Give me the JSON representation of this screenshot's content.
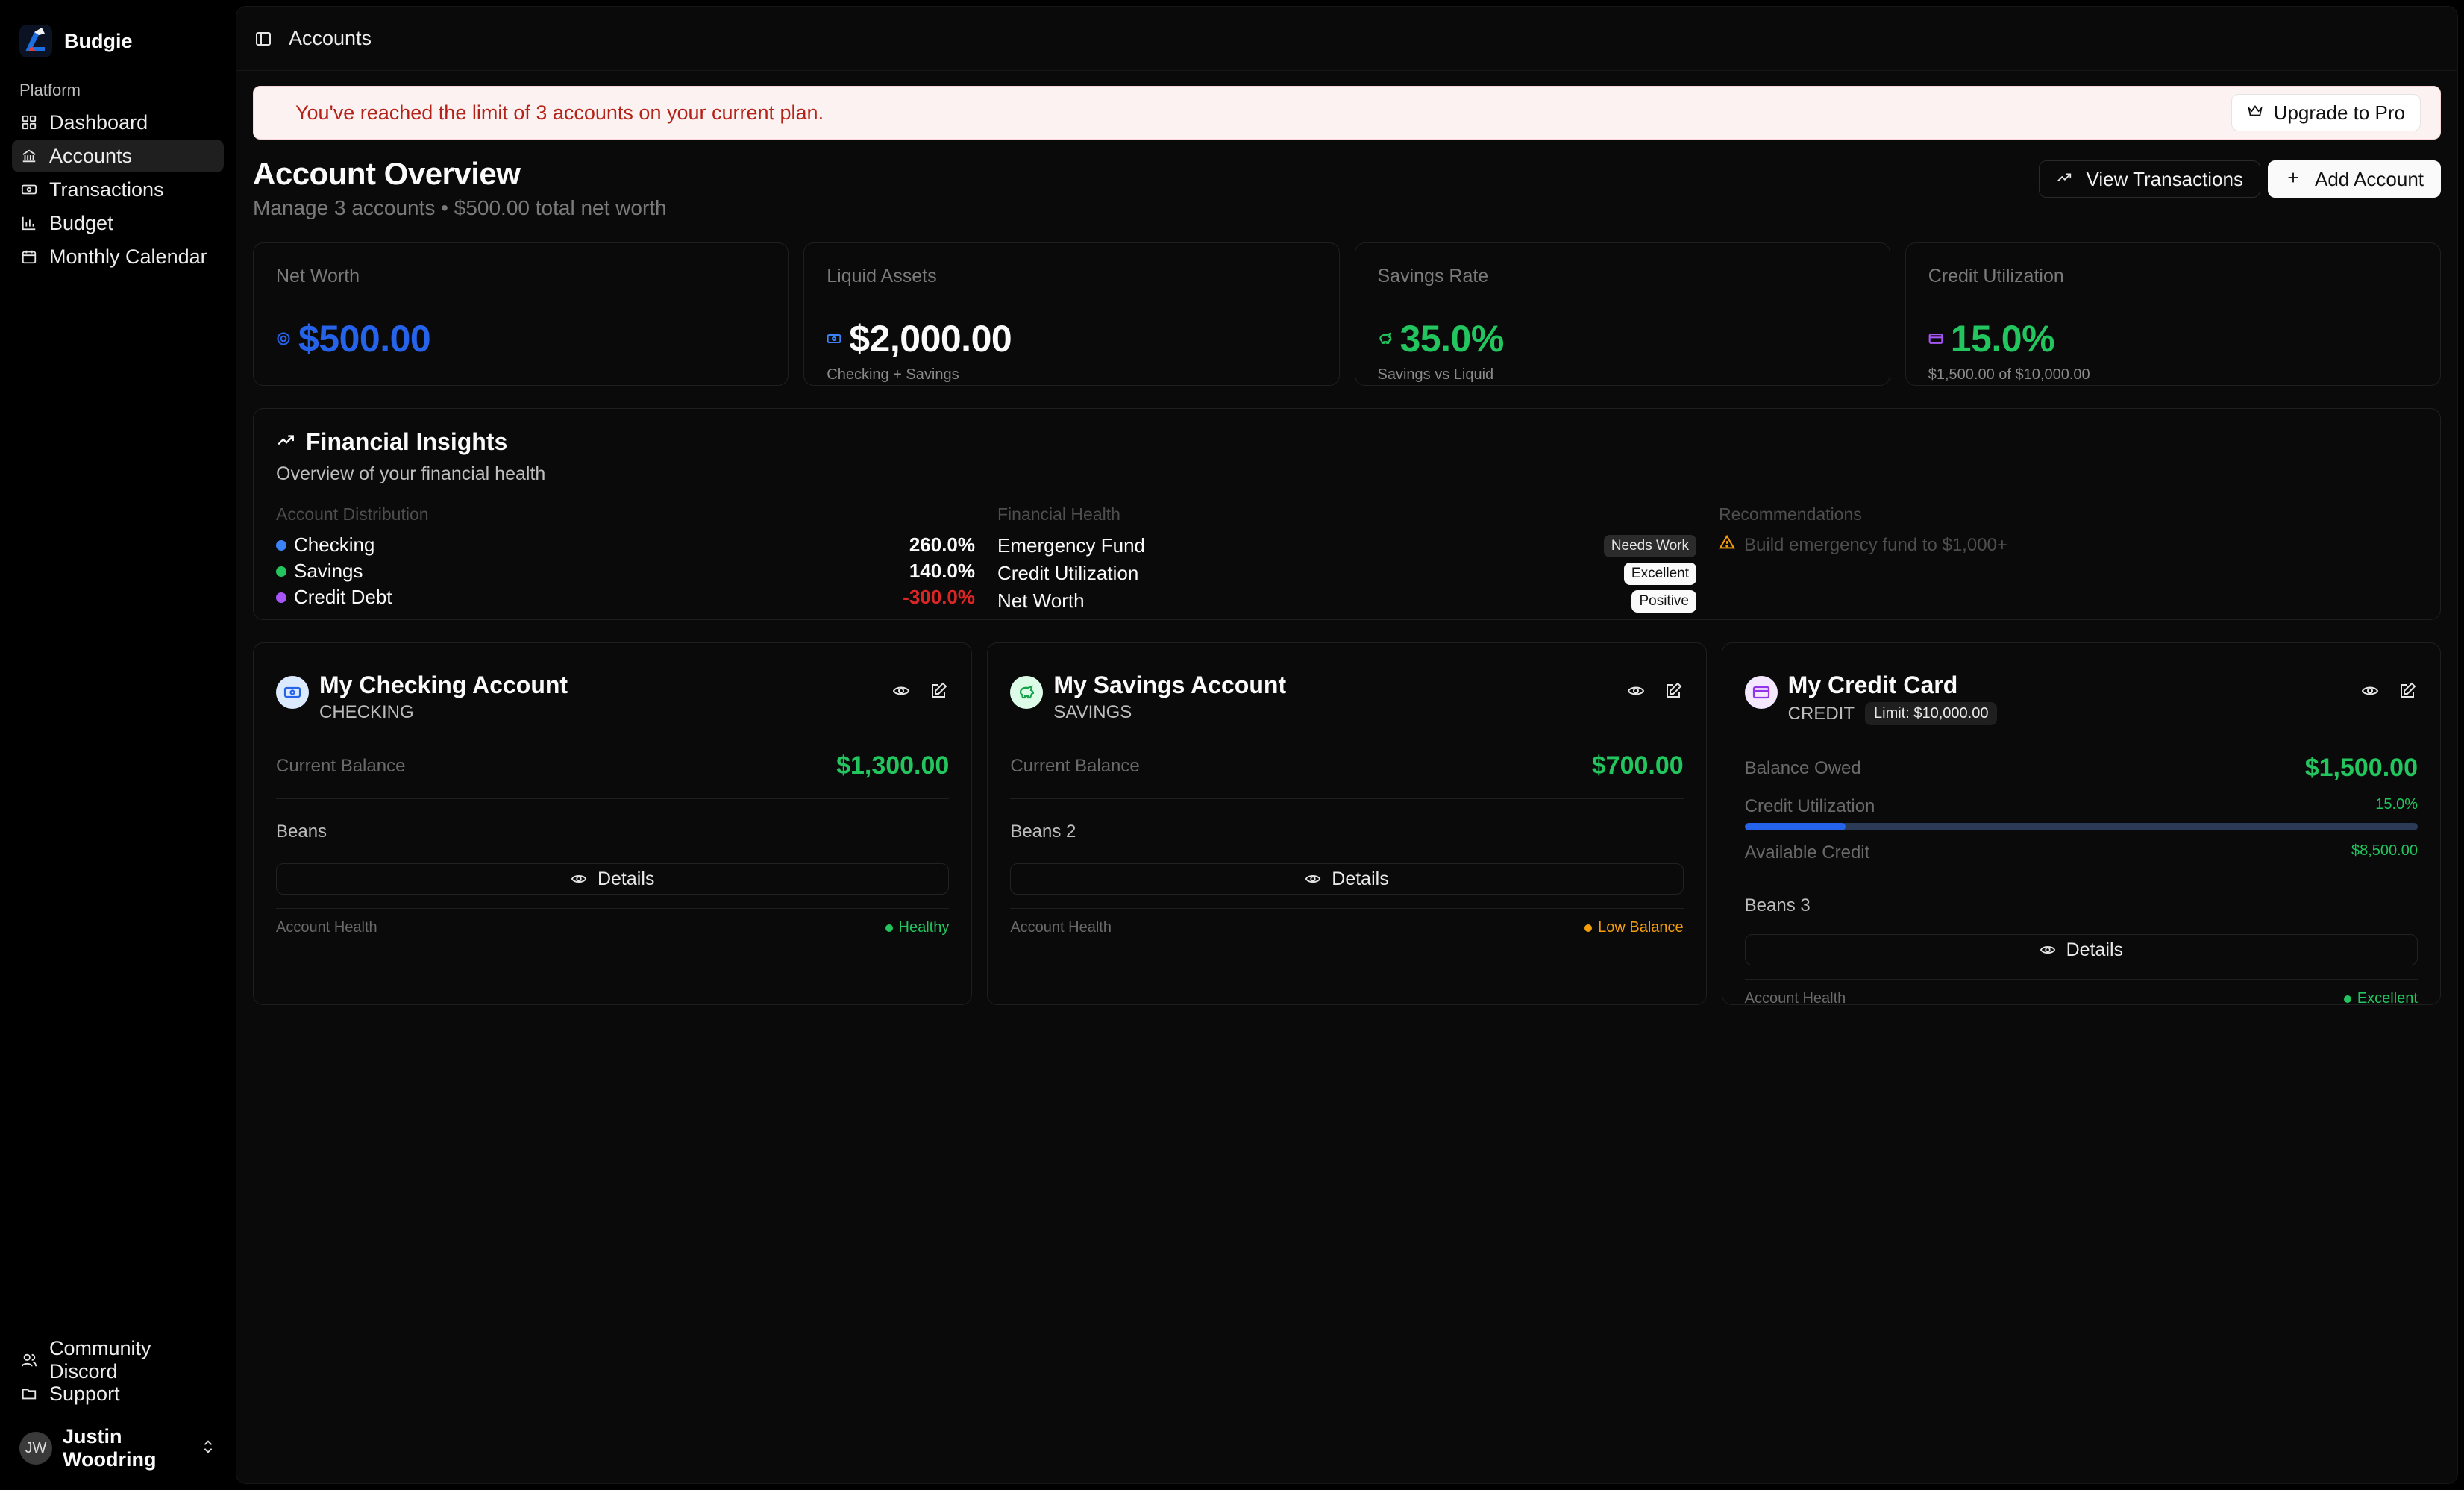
{
  "brand": {
    "name": "Budgie"
  },
  "sidebar": {
    "group_label": "Platform",
    "items": [
      {
        "label": "Dashboard",
        "icon": "grid-icon"
      },
      {
        "label": "Accounts",
        "icon": "bank-icon"
      },
      {
        "label": "Transactions",
        "icon": "banknote-icon"
      },
      {
        "label": "Budget",
        "icon": "chart-icon"
      },
      {
        "label": "Monthly Calendar",
        "icon": "calendar-icon"
      }
    ],
    "footer_items": [
      {
        "label": "Community Discord",
        "icon": "users-icon"
      },
      {
        "label": "Support",
        "icon": "folder-icon"
      }
    ],
    "user": {
      "initials": "JW",
      "name": "Justin Woodring"
    }
  },
  "header": {
    "title": "Accounts"
  },
  "banner": {
    "text": "You've reached the limit of 3 accounts on your current plan.",
    "upgrade_label": "Upgrade to Pro"
  },
  "overview": {
    "title": "Account Overview",
    "subtitle": "Manage 3 accounts • $500.00 total net worth",
    "view_transactions_label": "View Transactions",
    "add_account_label": "Add Account"
  },
  "stats": [
    {
      "label": "Net Worth",
      "value": "$500.00",
      "sub": "",
      "color": "#2563eb"
    },
    {
      "label": "Liquid Assets",
      "value": "$2,000.00",
      "sub": "Checking + Savings",
      "color": "#fafafa"
    },
    {
      "label": "Savings Rate",
      "value": "35.0%",
      "sub": "Savings vs Liquid",
      "color": "#22c55e"
    },
    {
      "label": "Credit Utilization",
      "value": "15.0%",
      "sub": "$1,500.00 of $10,000.00",
      "color": "#22c55e"
    }
  ],
  "insights": {
    "title": "Financial Insights",
    "subtitle": "Overview of your financial health",
    "distribution_label": "Account Distribution",
    "distribution": [
      {
        "label": "Checking",
        "value": "260.0%",
        "color": "#3b82f6"
      },
      {
        "label": "Savings",
        "value": "140.0%",
        "color": "#22c55e"
      },
      {
        "label": "Credit Debt",
        "value": "-300.0%",
        "color": "#a855f7"
      }
    ],
    "health_label": "Financial Health",
    "health": [
      {
        "label": "Emergency Fund",
        "status": "Needs Work"
      },
      {
        "label": "Credit Utilization",
        "status": "Excellent"
      },
      {
        "label": "Net Worth",
        "status": "Positive"
      }
    ],
    "recommendations_label": "Recommendations",
    "recommendations": [
      "Build emergency fund to $1,000+"
    ]
  },
  "accounts": [
    {
      "name": "My Checking Account",
      "type": "CHECKING",
      "balance_label": "Current Balance",
      "balance": "$1,300.00",
      "note": "Beans",
      "details_label": "Details",
      "health_label": "Account Health",
      "health_status": "Healthy",
      "health_color": "#22c55e"
    },
    {
      "name": "My Savings Account",
      "type": "SAVINGS",
      "balance_label": "Current Balance",
      "balance": "$700.00",
      "note": "Beans 2",
      "details_label": "Details",
      "health_label": "Account Health",
      "health_status": "Low Balance",
      "health_color": "#f59e0b"
    },
    {
      "name": "My Credit Card",
      "type": "CREDIT",
      "limit": "Limit: $10,000.00",
      "balance_label": "Balance Owed",
      "balance": "$1,500.00",
      "utilization_label": "Credit Utilization",
      "utilization": "15.0%",
      "utilization_fraction": 0.15,
      "available_label": "Available Credit",
      "available": "$8,500.00",
      "note": "Beans 3",
      "details_label": "Details",
      "health_label": "Account Health",
      "health_status": "Excellent",
      "health_color": "#22c55e"
    }
  ]
}
